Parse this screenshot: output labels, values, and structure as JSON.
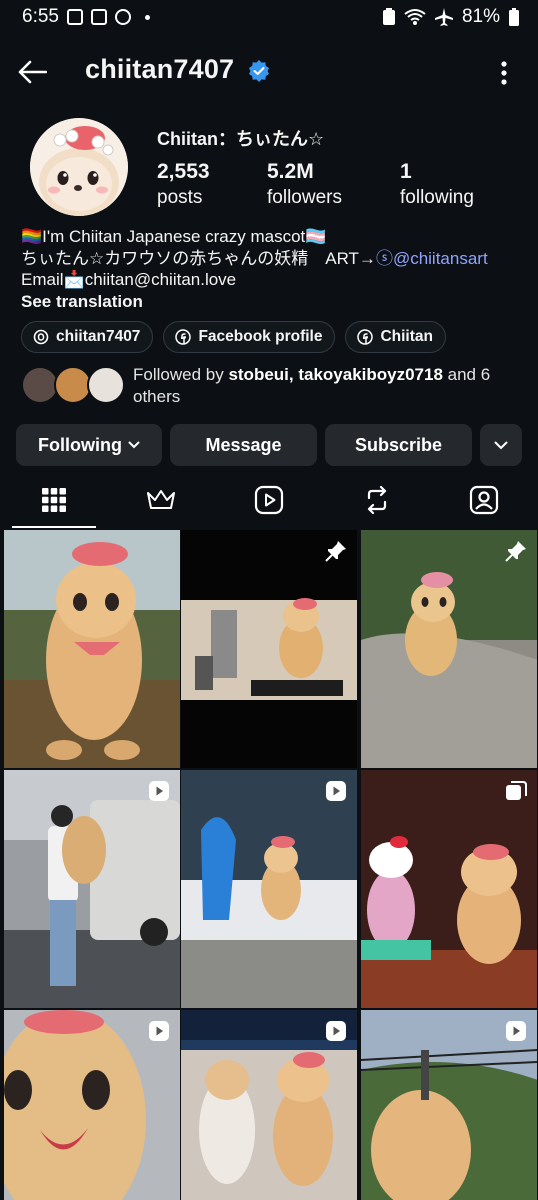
{
  "status_bar": {
    "time": "6:55",
    "battery": "81%"
  },
  "header": {
    "username": "chiitan7407",
    "verified": true
  },
  "profile": {
    "display_name": "Chiitan：ちぃたん☆",
    "stats": [
      {
        "value": "2,553",
        "label": "posts"
      },
      {
        "value": "5.2M",
        "label": "followers"
      },
      {
        "value": "1",
        "label": "following"
      }
    ],
    "bio": {
      "line1_prefix": "🏳️‍🌈",
      "line1_text": "I'm Chiitan Japanese crazy mascot",
      "line1_suffix": "🏳️‍⚧️",
      "line2_text": "ちぃたん☆カワウソの赤ちゃんの妖精　ART→",
      "line2_link": "@chiitansart",
      "line3_prefix": "Email",
      "line3_emoji": "📩",
      "line3_text": "chiitan@chiitan.love",
      "see_translation": "See translation"
    },
    "chips": [
      {
        "label": "chiitan7407",
        "icon": "threads-icon"
      },
      {
        "label": "Facebook profile",
        "icon": "facebook-icon"
      },
      {
        "label": "Chiitan",
        "icon": "facebook-icon"
      }
    ],
    "followed_by": {
      "prefix": "Followed by ",
      "names": "stobeui, takoyakiboyz0718",
      "suffix": " and 6 others"
    }
  },
  "actions": {
    "following": "Following",
    "message": "Message",
    "subscribe": "Subscribe"
  },
  "tabs": [
    "grid-icon",
    "crown-icon",
    "reels-icon",
    "repost-icon",
    "tagged-icon"
  ],
  "colors": {
    "background": "#0c1014",
    "button": "#25292e",
    "link": "#8fa3ff",
    "verified": "#3797f0"
  }
}
